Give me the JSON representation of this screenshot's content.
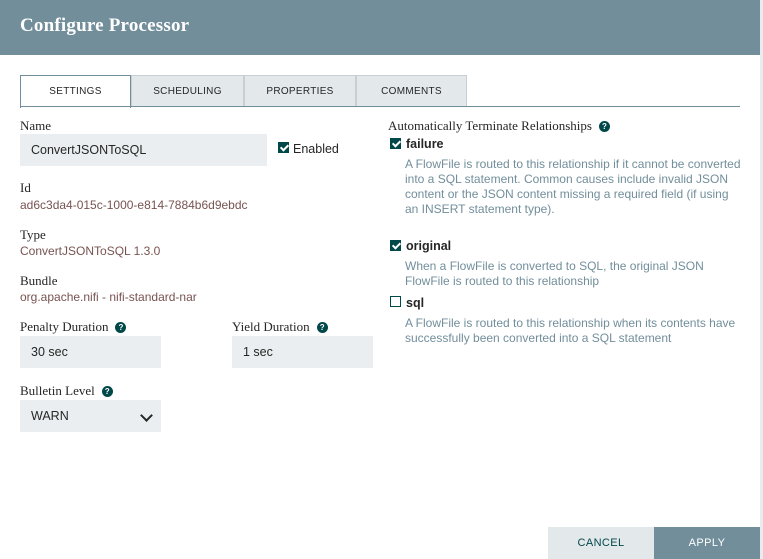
{
  "dialog": {
    "title": "Configure Processor"
  },
  "tabs": [
    {
      "label": "SETTINGS"
    },
    {
      "label": "SCHEDULING"
    },
    {
      "label": "PROPERTIES"
    },
    {
      "label": "COMMENTS"
    }
  ],
  "settings": {
    "name_label": "Name",
    "name_value": "ConvertJSONToSQL",
    "enabled_label": "Enabled",
    "enabled": true,
    "id_label": "Id",
    "id_value": "ad6c3da4-015c-1000-e814-7884b6d9ebdc",
    "type_label": "Type",
    "type_value": "ConvertJSONToSQL 1.3.0",
    "bundle_label": "Bundle",
    "bundle_value": "org.apache.nifi - nifi-standard-nar",
    "penalty_label": "Penalty Duration",
    "penalty_value": "30 sec",
    "yield_label": "Yield Duration",
    "yield_value": "1 sec",
    "bulletin_label": "Bulletin Level",
    "bulletin_value": "WARN"
  },
  "relationships": {
    "title": "Automatically Terminate Relationships",
    "items": [
      {
        "name": "failure",
        "checked": true,
        "description": "A FlowFile is routed to this relationship if it cannot be converted into a SQL statement. Common causes include invalid JSON content or the JSON content missing a required field (if using an INSERT statement type)."
      },
      {
        "name": "original",
        "checked": true,
        "description": "When a FlowFile is converted to SQL, the original JSON FlowFile is routed to this relationship"
      },
      {
        "name": "sql",
        "checked": false,
        "description": "A FlowFile is routed to this relationship when its contents have successfully been converted into a SQL statement"
      }
    ]
  },
  "buttons": {
    "cancel": "CANCEL",
    "apply": "APPLY"
  },
  "help_glyph": "?",
  "colors": {
    "header": "#728e9b",
    "accent": "#004849",
    "value_text": "#775351"
  }
}
